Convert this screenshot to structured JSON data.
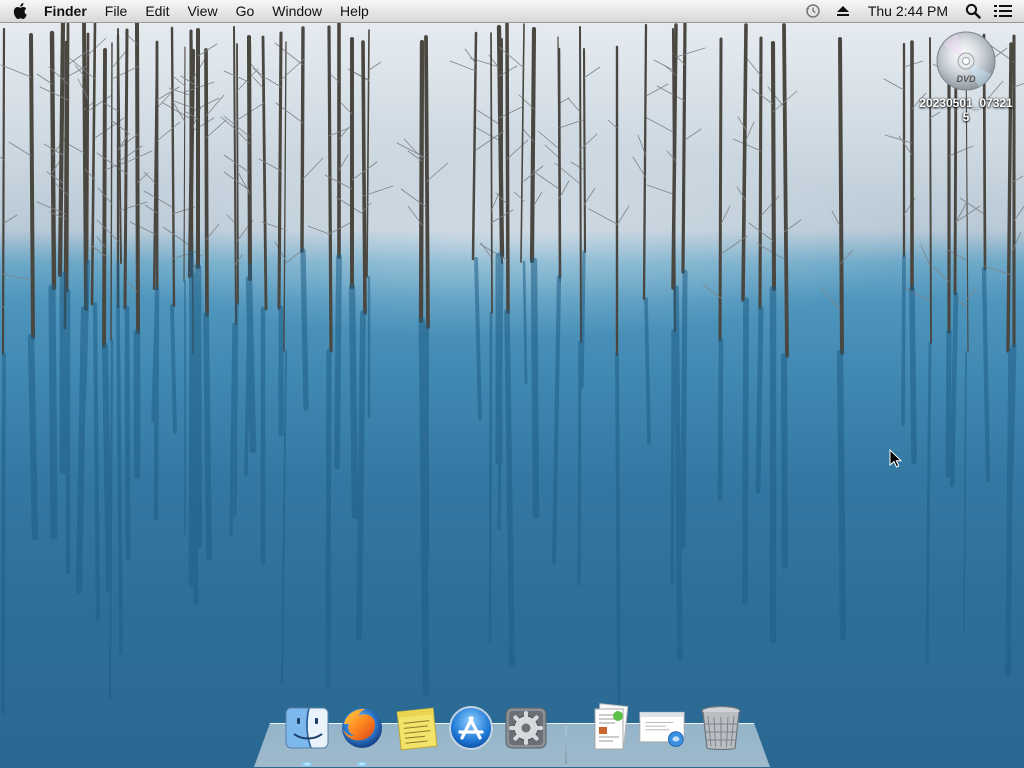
{
  "menubar": {
    "app_name": "Finder",
    "menus": [
      "File",
      "Edit",
      "View",
      "Go",
      "Window",
      "Help"
    ],
    "clock": "Thu 2:44 PM",
    "status_icons": [
      "time-machine-icon",
      "eject-icon",
      "spotlight-icon",
      "notification-list-icon"
    ]
  },
  "desktop": {
    "dvd": {
      "icon": "dvd-disc-icon",
      "label": "20230501_073215",
      "disc_text": "DVD"
    }
  },
  "dock": {
    "items": [
      {
        "name": "Finder",
        "icon": "finder-icon",
        "running": true
      },
      {
        "name": "Firefox",
        "icon": "firefox-icon",
        "running": true
      },
      {
        "name": "Stickies",
        "icon": "stickies-icon",
        "running": false
      },
      {
        "name": "App Store",
        "icon": "app-store-icon",
        "running": false
      },
      {
        "name": "System Preferences",
        "icon": "system-preferences-icon",
        "running": false
      },
      {
        "name": "Documents",
        "icon": "documents-stack-icon",
        "running": false
      },
      {
        "name": "Downloads",
        "icon": "downloads-stack-icon",
        "running": false
      },
      {
        "name": "Trash",
        "icon": "trash-icon",
        "running": false
      }
    ]
  },
  "colors": {
    "menubar_bg": "#e6e6e6",
    "water": "#3a83ad",
    "snow": "#e9eef2"
  }
}
